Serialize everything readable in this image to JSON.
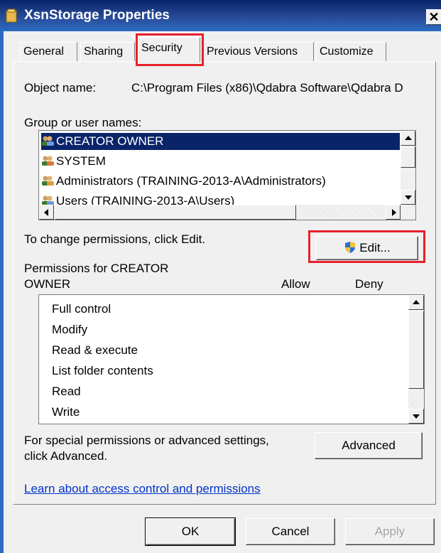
{
  "window": {
    "title": "XsnStorage Properties",
    "close_label": "✕"
  },
  "tabs": [
    {
      "label": "General"
    },
    {
      "label": "Sharing"
    },
    {
      "label": "Security"
    },
    {
      "label": "Previous Versions"
    },
    {
      "label": "Customize"
    }
  ],
  "security": {
    "object_name_label": "Object name:",
    "object_name_value": "C:\\Program Files (x86)\\Qdabra Software\\Qdabra D",
    "group_label": "Group or user names:",
    "users": [
      {
        "name": "CREATOR OWNER",
        "selected": true
      },
      {
        "name": "SYSTEM",
        "selected": false
      },
      {
        "name": "Administrators (TRAINING-2013-A\\Administrators)",
        "selected": false
      },
      {
        "name": "Users (TRAINING-2013-A\\Users)",
        "selected": false
      }
    ],
    "change_text": "To change permissions, click Edit.",
    "edit_button": "Edit...",
    "perm_label_line1": "Permissions for CREATOR",
    "perm_label_line2": "OWNER",
    "allow_header": "Allow",
    "deny_header": "Deny",
    "permissions": [
      "Full control",
      "Modify",
      "Read & execute",
      "List folder contents",
      "Read",
      "Write"
    ],
    "special_line1": "For special permissions or advanced settings,",
    "special_line2": "click Advanced.",
    "advanced_button": "Advanced",
    "learn_link": "Learn about access control and permissions"
  },
  "footer": {
    "ok": "OK",
    "cancel": "Cancel",
    "apply": "Apply"
  },
  "colors": {
    "highlight": "#e8202a",
    "selection": "#0a246a",
    "link": "#0033cc",
    "titlebar": "#0a246a"
  },
  "icons": {
    "folder": "folder-icon",
    "users": "user-group-icon",
    "shield": "uac-shield-icon"
  }
}
